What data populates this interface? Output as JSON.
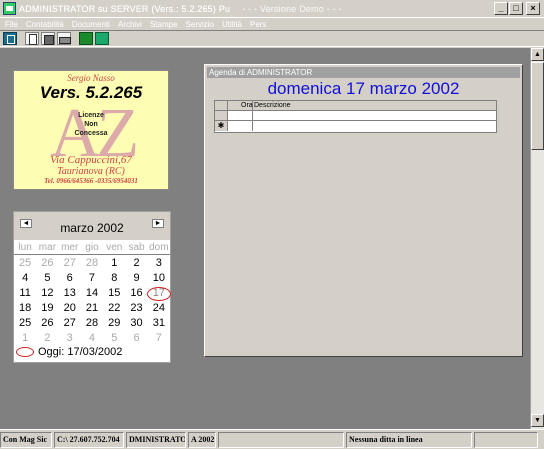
{
  "window": {
    "title": "ADMINISTRATOR su SERVER (Vers.: 5.2.265) Pu",
    "title_suffix": "- - - Versione Demo - - -"
  },
  "menu": [
    "File",
    "Contabilità",
    "Documenti",
    "Archivi",
    "Stampe",
    "Servizio",
    "Utilità",
    "Pers"
  ],
  "logo": {
    "name": "Sergio Nasso",
    "version": "Vers. 5.2.265",
    "license_line1": "Licenze",
    "license_line2": "Non",
    "license_line3": "Concessa",
    "mark": "AZ",
    "address1": "Via Cappuccini,67",
    "address2": "Taurianova (RC)",
    "phone": "Tel. 0966/645366 -0335/6954031"
  },
  "calendar": {
    "month_title": "marzo 2002",
    "prev": "◄",
    "next": "►",
    "day_names": [
      "lun",
      "mar",
      "mer",
      "gio",
      "ven",
      "sab",
      "dom"
    ],
    "weeks": [
      [
        {
          "d": "25",
          "o": true
        },
        {
          "d": "26",
          "o": true
        },
        {
          "d": "27",
          "o": true
        },
        {
          "d": "28",
          "o": true
        },
        {
          "d": "1"
        },
        {
          "d": "2"
        },
        {
          "d": "3"
        }
      ],
      [
        {
          "d": "4"
        },
        {
          "d": "5"
        },
        {
          "d": "6"
        },
        {
          "d": "7"
        },
        {
          "d": "8"
        },
        {
          "d": "9"
        },
        {
          "d": "10"
        }
      ],
      [
        {
          "d": "11"
        },
        {
          "d": "12"
        },
        {
          "d": "13"
        },
        {
          "d": "14"
        },
        {
          "d": "15"
        },
        {
          "d": "16"
        },
        {
          "d": "17",
          "t": true
        }
      ],
      [
        {
          "d": "18"
        },
        {
          "d": "19"
        },
        {
          "d": "20"
        },
        {
          "d": "21"
        },
        {
          "d": "22"
        },
        {
          "d": "23"
        },
        {
          "d": "24"
        }
      ],
      [
        {
          "d": "25"
        },
        {
          "d": "26"
        },
        {
          "d": "27"
        },
        {
          "d": "28"
        },
        {
          "d": "29"
        },
        {
          "d": "30"
        },
        {
          "d": "31"
        }
      ],
      [
        {
          "d": "1",
          "o": true
        },
        {
          "d": "2",
          "o": true
        },
        {
          "d": "3",
          "o": true
        },
        {
          "d": "4",
          "o": true
        },
        {
          "d": "5",
          "o": true
        },
        {
          "d": "6",
          "o": true
        },
        {
          "d": "7",
          "o": true
        }
      ]
    ],
    "today_label": "Oggi: 17/03/2002"
  },
  "agenda": {
    "window_title": "Agenda di ADMINISTRATOR",
    "date_heading": "domenica 17 marzo 2002",
    "col_ora": "Ora",
    "col_descrizione": "Descrizione",
    "new_row_marker": "✱"
  },
  "statusbar": [
    "Con Mag Sic",
    "C:\\  27.607.752.704",
    "DMINISTRATO)",
    "A 2002",
    "",
    "Nessuna ditta in linea",
    ""
  ],
  "colors": {
    "agenda_date": "#1010d8",
    "logo_bg": "#fdfdb3",
    "workspace": "#808080",
    "today_circle": "#cc2222"
  }
}
